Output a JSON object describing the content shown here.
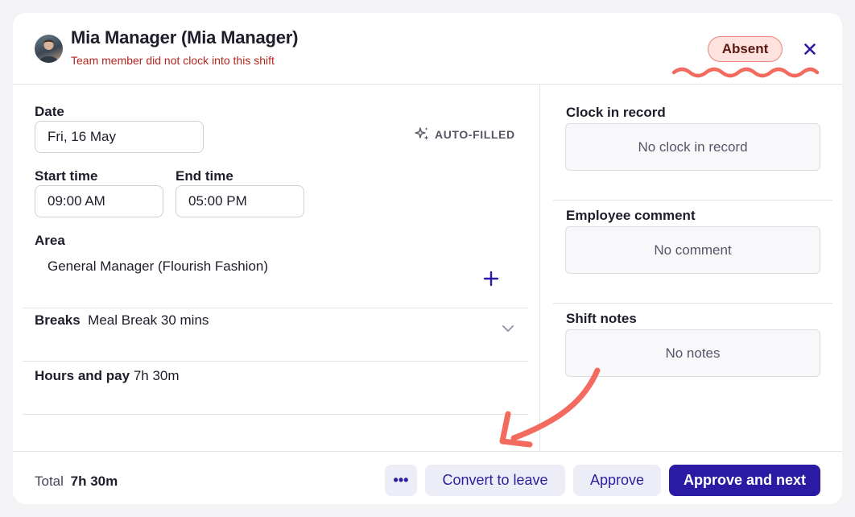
{
  "header": {
    "name": "Mia Manager (Mia Manager)",
    "subtitle": "Team member did not clock into this shift",
    "status_badge": "Absent",
    "accent_color": "#2b1aa3",
    "alert_color": "#b3261e"
  },
  "shift": {
    "date_label": "Date",
    "date_value": "Fri, 16 May",
    "auto_filled_label": "AUTO-FILLED",
    "start_label": "Start time",
    "start_value": "09:00 AM",
    "end_label": "End time",
    "end_value": "05:00 PM",
    "area_label": "Area",
    "area_value": "General Manager (Flourish Fashion)",
    "breaks_label": "Breaks",
    "breaks_value": "Meal Break 30 mins",
    "hours_label": "Hours and pay",
    "hours_value": "7h 30m"
  },
  "side": {
    "clock_label": "Clock in record",
    "clock_value": "No clock in record",
    "comment_label": "Employee comment",
    "comment_value": "No comment",
    "notes_label": "Shift notes",
    "notes_value": "No notes"
  },
  "footer": {
    "total_label": "Total",
    "total_value": "7h 30m",
    "more_label": "•••",
    "convert_label": "Convert to leave",
    "approve_label": "Approve",
    "approve_next_label": "Approve and next"
  },
  "icons": {
    "close": "close-icon",
    "sparkle": "sparkle-icon",
    "plus": "plus-icon",
    "chevron": "chevron-down-icon"
  }
}
